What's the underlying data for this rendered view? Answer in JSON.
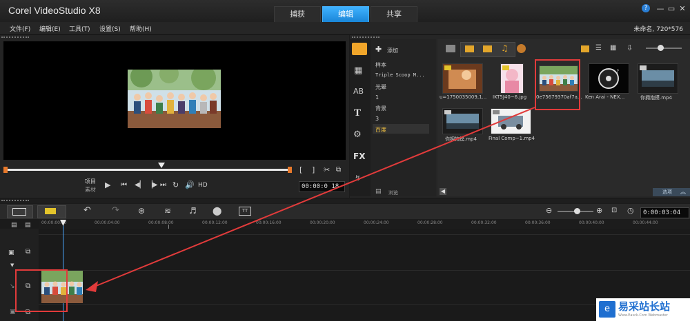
{
  "app": {
    "title": "Corel VideoStudio X8",
    "project_info": "未命名, 720*576"
  },
  "tabs": [
    "捕获",
    "编辑",
    "共享"
  ],
  "window_buttons": [
    "—",
    "▭",
    "✕"
  ],
  "menu": [
    "文件(F)",
    "编辑(E)",
    "工具(T)",
    "设置(S)",
    "帮助(H)"
  ],
  "preview": {
    "mode_labels": [
      "项目",
      "素材"
    ],
    "hd": "HD",
    "timecode": "00:00:0 18",
    "bracket_in": "[",
    "bracket_out": "]"
  },
  "library": {
    "add_label": "添加",
    "categories": [
      "样本",
      "Triple Scoop M...",
      "光晕",
      "1",
      "背景",
      "3",
      "百度"
    ],
    "selected_category": "百度",
    "browse_label": "浏览",
    "options_label": "选项",
    "items": [
      {
        "label": "u=1750035009,1..."
      },
      {
        "label": "IKT5J40~6.jpg"
      },
      {
        "label": "0e75679370af7a..."
      },
      {
        "label": "Ken Arai - NEX..."
      },
      {
        "label": "你拥抱摸.mp4"
      },
      {
        "label": "你拥抱摸.mp4"
      },
      {
        "label": "Final Comp~1.mp4"
      }
    ]
  },
  "timeline": {
    "timecode": "0:00:03:04",
    "ruler": [
      "00:00:00:00",
      "00:00:04:00",
      "00:00:08:00",
      "00:00:12:00",
      "00:00:16:00",
      "00:00:20:00",
      "00:00:24:00",
      "00:00:28:00",
      "00:00:32:00",
      "00:00:36:00",
      "00:00:40:00",
      "00:00:44:00"
    ]
  },
  "watermark": {
    "title": "易采站长站",
    "subtitle": "Www.Easck.Com  Webmaster"
  },
  "colors": {
    "accent": "#1a86d8",
    "highlight": "#e23b3b",
    "background": "#1b1b1b"
  }
}
